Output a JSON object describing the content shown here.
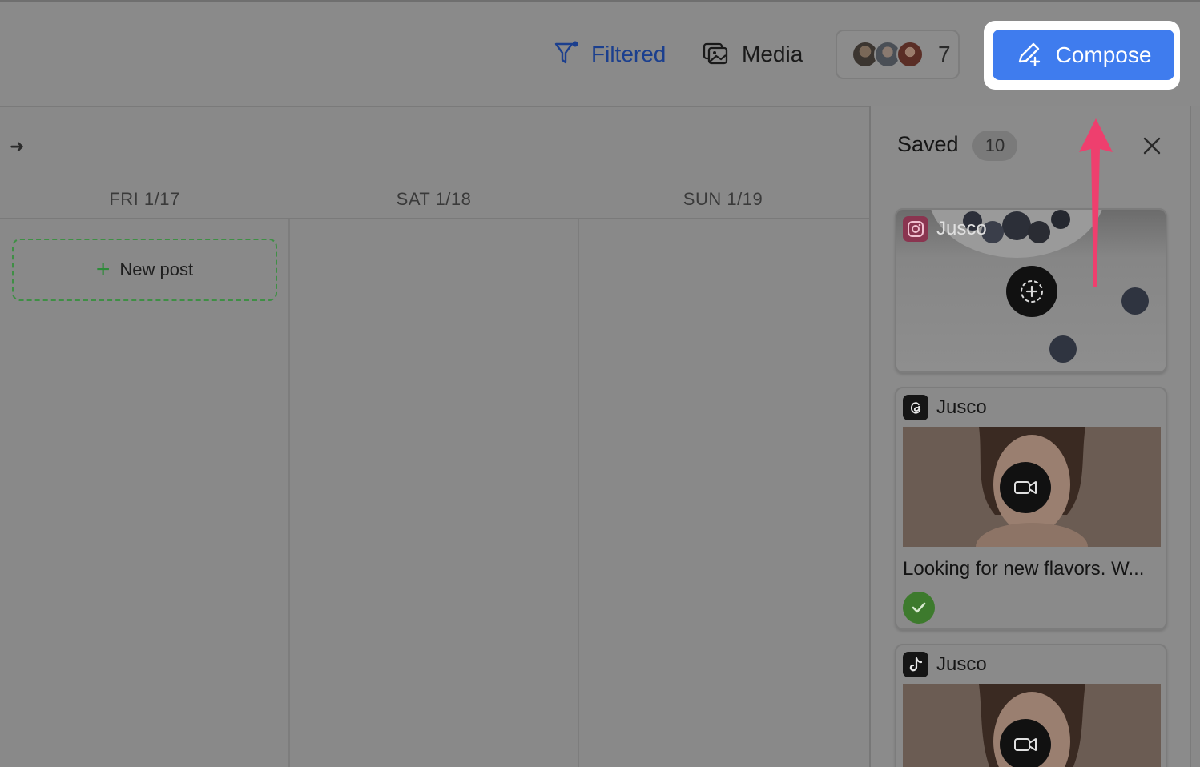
{
  "header": {
    "filter_label": "Filtered",
    "media_label": "Media",
    "members_count": "7",
    "compose_label": "Compose"
  },
  "calendar": {
    "days": [
      "FRI 1/17",
      "SAT 1/18",
      "SUN 1/19"
    ],
    "new_post_label": "New post"
  },
  "saved_panel": {
    "title": "Saved",
    "count": "10",
    "cards": [
      {
        "network": "instagram",
        "account": "Jusco",
        "action_icon": "add-media-icon"
      },
      {
        "network": "threads",
        "account": "Jusco",
        "action_icon": "video-icon",
        "text": "Looking for new flavors. W...",
        "status": "approved"
      },
      {
        "network": "tiktok",
        "account": "Jusco",
        "action_icon": "video-icon"
      }
    ]
  },
  "colors": {
    "compose_bg": "#3f7cee",
    "filter_text": "#1b3f8e",
    "new_post_border": "#3f8f45",
    "pointer_arrow": "#ee3f6e",
    "approved": "#3d7a2d"
  }
}
